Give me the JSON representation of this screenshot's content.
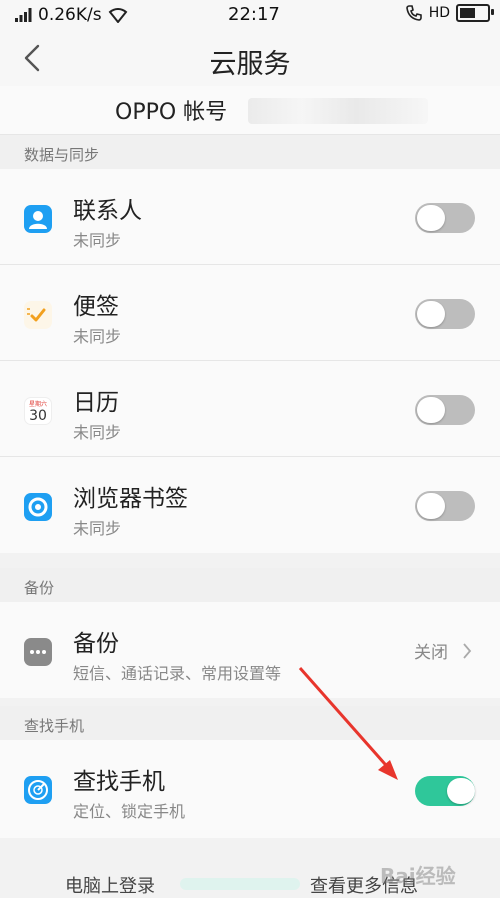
{
  "status_bar": {
    "speed": "0.26K/s",
    "time": "22:17",
    "hd_label": "HD",
    "battery_level": 0.7
  },
  "nav": {
    "title": "云服务"
  },
  "account": {
    "label": "OPPO 帐号"
  },
  "sections": {
    "data_sync": "数据与同步",
    "backup": "备份",
    "find_phone": "查找手机"
  },
  "sync_items": [
    {
      "name": "联系人",
      "status": "未同步",
      "icon": "contacts-icon",
      "color": "#1e9ff2",
      "enabled": false
    },
    {
      "name": "便签",
      "status": "未同步",
      "icon": "notes-icon",
      "color": "#f2a01e",
      "enabled": false
    },
    {
      "name": "日历",
      "status": "未同步",
      "icon": "calendar-icon",
      "color": "#e0413a",
      "enabled": false
    },
    {
      "name": "浏览器书签",
      "status": "未同步",
      "icon": "browser-icon",
      "color": "#1e9ff2",
      "enabled": false
    }
  ],
  "backup_item": {
    "name": "备份",
    "desc": "短信、通话记录、常用设置等",
    "value": "关闭",
    "icon": "backup-icon"
  },
  "find_item": {
    "name": "查找手机",
    "desc": "定位、锁定手机",
    "icon": "radar-icon",
    "enabled": true
  },
  "bottom": {
    "left": "电脑上登录",
    "right": "查看更多信息"
  },
  "calendar_icon_text": {
    "header": "星期六",
    "day": "30"
  },
  "watermark": "Bai经验",
  "colors": {
    "accent_toggle_on": "#2fc79a",
    "toggle_off": "#bdbdbd",
    "annotation_arrow": "#e8352c"
  }
}
